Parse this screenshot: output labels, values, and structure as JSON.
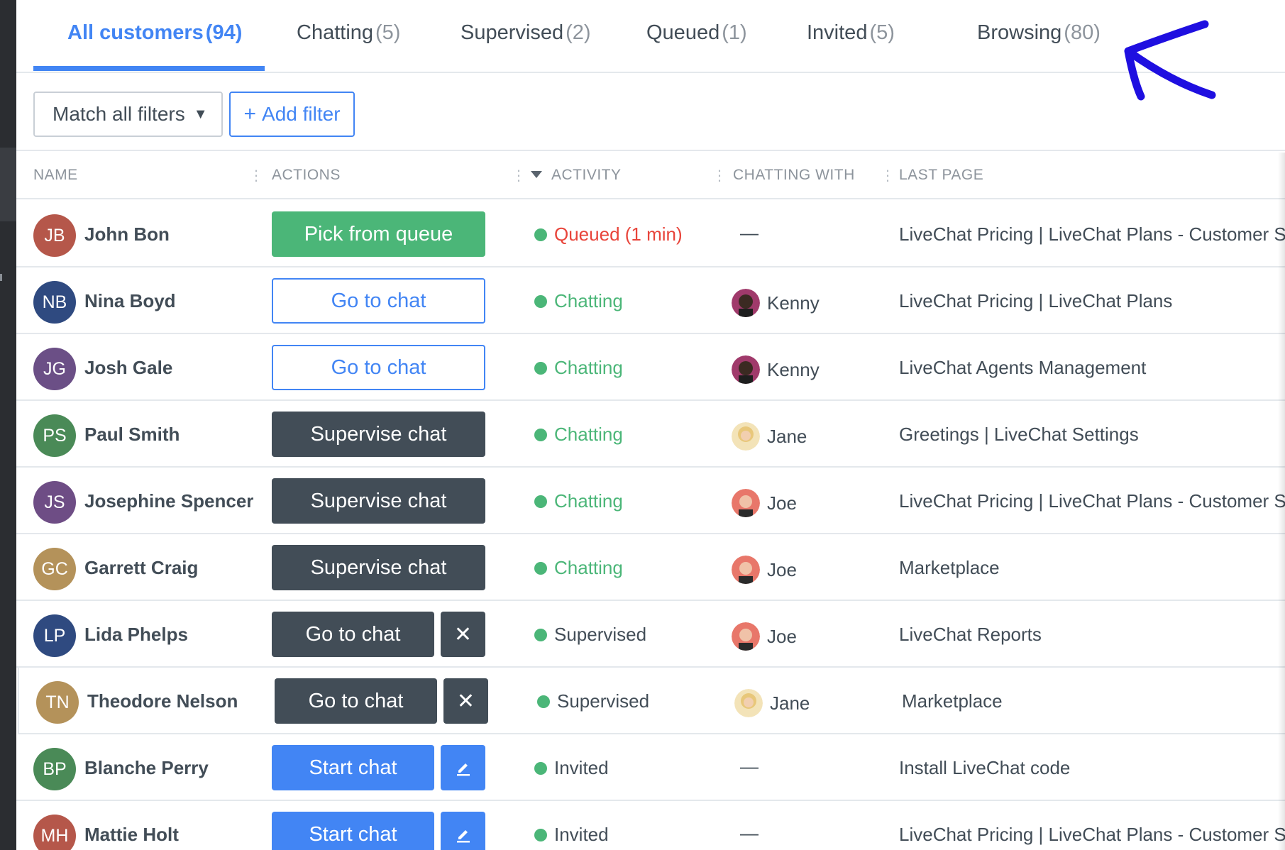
{
  "tabs": [
    {
      "label": "All customers",
      "count": "(94)",
      "active": true
    },
    {
      "label": "Chatting",
      "count": "(5)"
    },
    {
      "label": "Supervised",
      "count": "(2)"
    },
    {
      "label": "Queued",
      "count": "(1)"
    },
    {
      "label": "Invited",
      "count": "(5)"
    },
    {
      "label": "Browsing",
      "count": "(80)"
    }
  ],
  "filters": {
    "match_label": "Match all filters",
    "add_label": "Add filter"
  },
  "columns": {
    "name": "NAME",
    "actions": "ACTIONS",
    "activity": "ACTIVITY",
    "chatting_with": "CHATTING WITH",
    "last_page": "LAST PAGE"
  },
  "colors": {
    "accent_blue": "#4285f4",
    "green": "#4bb678",
    "dark": "#424d57",
    "queued_red": "#e8443a",
    "annotation": "#1f0fe0"
  },
  "rows": [
    {
      "initials": "JB",
      "name": "John Bon",
      "avatar_color": "#b5574a",
      "action": "Pick from queue",
      "status": "Queued (1 min)",
      "agent": "—",
      "last_page": "LiveChat Pricing | LiveChat Plans - Customer Service"
    },
    {
      "initials": "NB",
      "name": "Nina Boyd",
      "avatar_color": "#2f4a80",
      "action": "Go to chat",
      "status": "Chatting",
      "agent": "Kenny",
      "last_page": "LiveChat Pricing | LiveChat Plans"
    },
    {
      "initials": "JG",
      "name": "Josh Gale",
      "avatar_color": "#6b4f86",
      "action": "Go to chat",
      "status": "Chatting",
      "agent": "Kenny",
      "last_page": "LiveChat Agents Management"
    },
    {
      "initials": "PS",
      "name": "Paul Smith",
      "avatar_color": "#4a8a57",
      "action": "Supervise chat",
      "status": "Chatting",
      "agent": "Jane",
      "last_page": "Greetings | LiveChat Settings"
    },
    {
      "initials": "JS",
      "name": "Josephine Spencer",
      "avatar_color": "#6e4d85",
      "action": "Supervise chat",
      "status": "Chatting",
      "agent": "Joe",
      "last_page": "LiveChat Pricing | LiveChat Plans - Customer Service"
    },
    {
      "initials": "GC",
      "name": "Garrett Craig",
      "avatar_color": "#b4925a",
      "action": "Supervise chat",
      "status": "Chatting",
      "agent": "Joe",
      "last_page": "Marketplace"
    },
    {
      "initials": "LP",
      "name": "Lida Phelps",
      "avatar_color": "#2f4a80",
      "action": "Go to chat",
      "status": "Supervised",
      "agent": "Joe",
      "last_page": "LiveChat Reports"
    },
    {
      "initials": "TN",
      "name": "Theodore Nelson",
      "avatar_color": "#b4925a",
      "action": "Go to chat",
      "status": "Supervised",
      "agent": "Jane",
      "last_page": "Marketplace"
    },
    {
      "initials": "BP",
      "name": "Blanche Perry",
      "avatar_color": "#4a8a57",
      "action": "Start chat",
      "status": "Invited",
      "agent": "—",
      "last_page": "Install LiveChat code"
    },
    {
      "initials": "MH",
      "name": "Mattie Holt",
      "avatar_color": "#b5574a",
      "action": "Start chat",
      "status": "Invited",
      "agent": "—",
      "last_page": "LiveChat Pricing | LiveChat Plans - Customer Service"
    }
  ]
}
